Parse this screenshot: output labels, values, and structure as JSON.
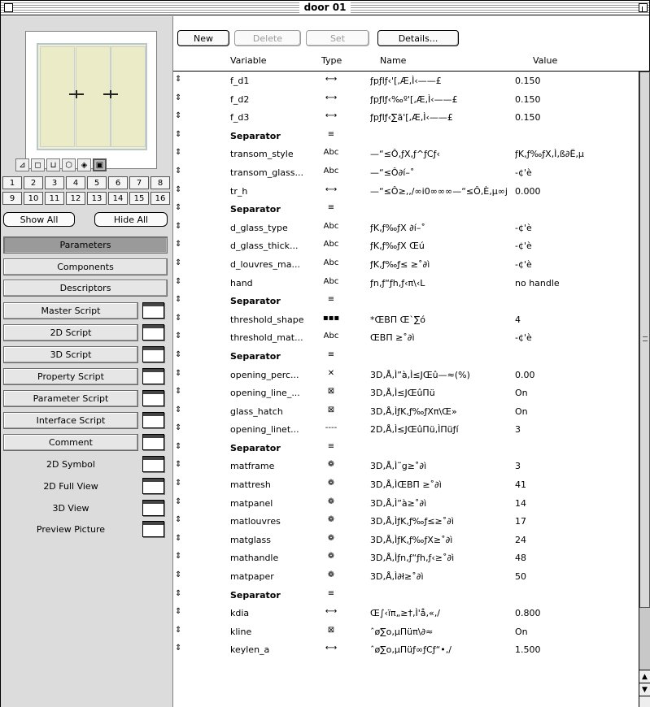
{
  "window": {
    "title": "door 01"
  },
  "toolbar": {
    "new_label": "New",
    "delete_label": "Delete",
    "set_label": "Set",
    "details_label": "Details..."
  },
  "columns": {
    "variable": "Variable",
    "type": "Type",
    "name": "Name",
    "value": "Value"
  },
  "left": {
    "view_icons": [
      "plan-icon",
      "side-view-icon",
      "front-view-icon",
      "3d-view-icon",
      "hidden-view-icon",
      "preview-icon"
    ],
    "numbers_row1": [
      "1",
      "2",
      "3",
      "4",
      "5",
      "6",
      "7",
      "8"
    ],
    "numbers_row2": [
      "9",
      "10",
      "11",
      "12",
      "13",
      "14",
      "15",
      "16"
    ],
    "show_all": "Show All",
    "hide_all": "Hide All",
    "nav": {
      "parameters": "Parameters",
      "components": "Components",
      "descriptors": "Descriptors",
      "master_script": "Master Script",
      "script_2d": "2D Script",
      "script_3d": "3D Script",
      "property_script": "Property Script",
      "parameter_script": "Parameter Script",
      "interface_script": "Interface Script",
      "comment": "Comment",
      "symbol_2d": "2D Symbol",
      "full_view_2d": "2D Full View",
      "view_3d": "3D View",
      "preview_picture": "Preview Picture"
    }
  },
  "rows": [
    {
      "drag": "⇕",
      "var": "f_d1",
      "type": "⟷",
      "name": "ƒpƒlƒ‹'[‚Æ‚Ì‹——£",
      "value": "0.150"
    },
    {
      "drag": "⇕",
      "var": "f_d2",
      "type": "⟷",
      "name": "ƒpƒlƒ‹‰º'[‚Æ‚Ì‹——£",
      "value": "0.150"
    },
    {
      "drag": "⇕",
      "var": "f_d3",
      "type": "⟷",
      "name": "ƒpƒlƒ‹∑ã'[‚Æ‚Ì‹——£",
      "value": "0.150"
    },
    {
      "drag": "⇕",
      "var": "Separator",
      "type": "≡",
      "name": "",
      "value": "",
      "sep": true
    },
    {
      "drag": "⇕",
      "var": "transom_style",
      "type": "Abc",
      "name": "—“≤Ô‚ƒX‚ƒ^ƒCƒ‹",
      "value": "ƒK‚ƒ‰ƒX‚Ì‚ß∂Ë‚µ"
    },
    {
      "drag": "⇕",
      "var": "transom_glass...",
      "type": "Abc",
      "name": "—“≤Ô∂í–˚",
      "value": "-¢'è"
    },
    {
      "drag": "⇕",
      "var": "tr_h",
      "type": "⟷",
      "name": "—“≤Ô≥‚‚/∞i0∞∞∞—“≤Ô‚È‚µ∞j",
      "value": "0.000"
    },
    {
      "drag": "⇕",
      "var": "Separator",
      "type": "≡",
      "name": "",
      "value": "",
      "sep": true
    },
    {
      "drag": "⇕",
      "var": "d_glass_type",
      "type": "Abc",
      "name": "ƒK‚ƒ‰ƒX ∂í–˚",
      "value": "-¢'è"
    },
    {
      "drag": "⇕",
      "var": "d_glass_thick...",
      "type": "Abc",
      "name": "ƒK‚ƒ‰ƒX Œú",
      "value": "-¢'è"
    },
    {
      "drag": "⇕",
      "var": "d_louvres_ma...",
      "type": "Abc",
      "name": "ƒK‚ƒ‰ƒ≤ ≥˚∂ì",
      "value": "-¢'è"
    },
    {
      "drag": "⇕",
      "var": "hand",
      "type": "Abc",
      "name": "ƒn‚ƒ“ƒh‚ƒ‹π\\‹L",
      "value": "no handle"
    },
    {
      "drag": "⇕",
      "var": "Separator",
      "type": "≡",
      "name": "",
      "value": "",
      "sep": true
    },
    {
      "drag": "⇕",
      "var": "threshold_shape",
      "type": "▪▪▪",
      "name": "*ŒBΠ Œ`∑ó",
      "value": "4"
    },
    {
      "drag": "⇕",
      "var": "threshold_mat...",
      "type": "Abc",
      "name": "ŒBΠ ≥˚∂ì",
      "value": "-¢'è"
    },
    {
      "drag": "⇕",
      "var": "Separator",
      "type": "≡",
      "name": "",
      "value": "",
      "sep": true
    },
    {
      "drag": "⇕",
      "var": "opening_perc...",
      "type": "✕",
      "name": "3D‚Å‚Ì”à‚Ì≤JŒû—≈(%)",
      "value": "0.00"
    },
    {
      "drag": "⇕",
      "var": "opening_line_...",
      "type": "⊠",
      "name": "3D‚Å‚Ì≤JŒûΠü",
      "value": "On"
    },
    {
      "drag": "⇕",
      "var": "glass_hatch",
      "type": "⊠",
      "name": "3D‚Å‚ÌƒK‚ƒ‰ƒXπ\\Œ»",
      "value": "On"
    },
    {
      "drag": "⇕",
      "var": "opening_linet...",
      "type": "----",
      "name": "2D‚Å‚Ì≤JŒûΠü‚ÌΠüƒí",
      "value": "3"
    },
    {
      "drag": "⇕",
      "var": "Separator",
      "type": "≡",
      "name": "",
      "value": "",
      "sep": true
    },
    {
      "drag": "⇕",
      "var": "matframe",
      "type": "❁",
      "name": "3D‚Å‚Ì˜g≥˚∂ì",
      "value": "3"
    },
    {
      "drag": "⇕",
      "var": "mattresh",
      "type": "❁",
      "name": "3D‚Å‚ÌŒBΠ ≥˚∂ì",
      "value": "41"
    },
    {
      "drag": "⇕",
      "var": "matpanel",
      "type": "❁",
      "name": "3D‚Å‚Ì”à≥˚∂ì",
      "value": "14"
    },
    {
      "drag": "⇕",
      "var": "matlouvres",
      "type": "❁",
      "name": "3D‚Å‚ÌƒK‚ƒ‰ƒ≤≥˚∂ì",
      "value": "17"
    },
    {
      "drag": "⇕",
      "var": "matglass",
      "type": "❁",
      "name": "3D‚Å‚ÌƒK‚ƒ‰ƒX≥˚∂ì",
      "value": "24"
    },
    {
      "drag": "⇕",
      "var": "mathandle",
      "type": "❁",
      "name": "3D‚Å‚Ìƒn‚ƒ“ƒh‚ƒ‹≥˚∂ì",
      "value": "48"
    },
    {
      "drag": "⇕",
      "var": "matpaper",
      "type": "❁",
      "name": "3D‚Å‚Ì∂ł≥˚∂ì",
      "value": "50"
    },
    {
      "drag": "⇕",
      "var": "Separator",
      "type": "≡",
      "name": "",
      "value": "",
      "sep": true
    },
    {
      "drag": "⇕",
      "var": "kdia",
      "type": "⟷",
      "name": "Œ∫‹ïπ„≥†‚Ì'å‚«‚/",
      "value": "0.800"
    },
    {
      "drag": "⇕",
      "var": "kline",
      "type": "⊠",
      "name": "ˆø∑o‚µΠüπ\\∂≈",
      "value": "On"
    },
    {
      "drag": "⇕",
      "var": "keylen_a",
      "type": "⟷",
      "name": "ˆø∑o‚µΠüƒ∞ƒCƒ“•‚/",
      "value": "1.500"
    }
  ]
}
